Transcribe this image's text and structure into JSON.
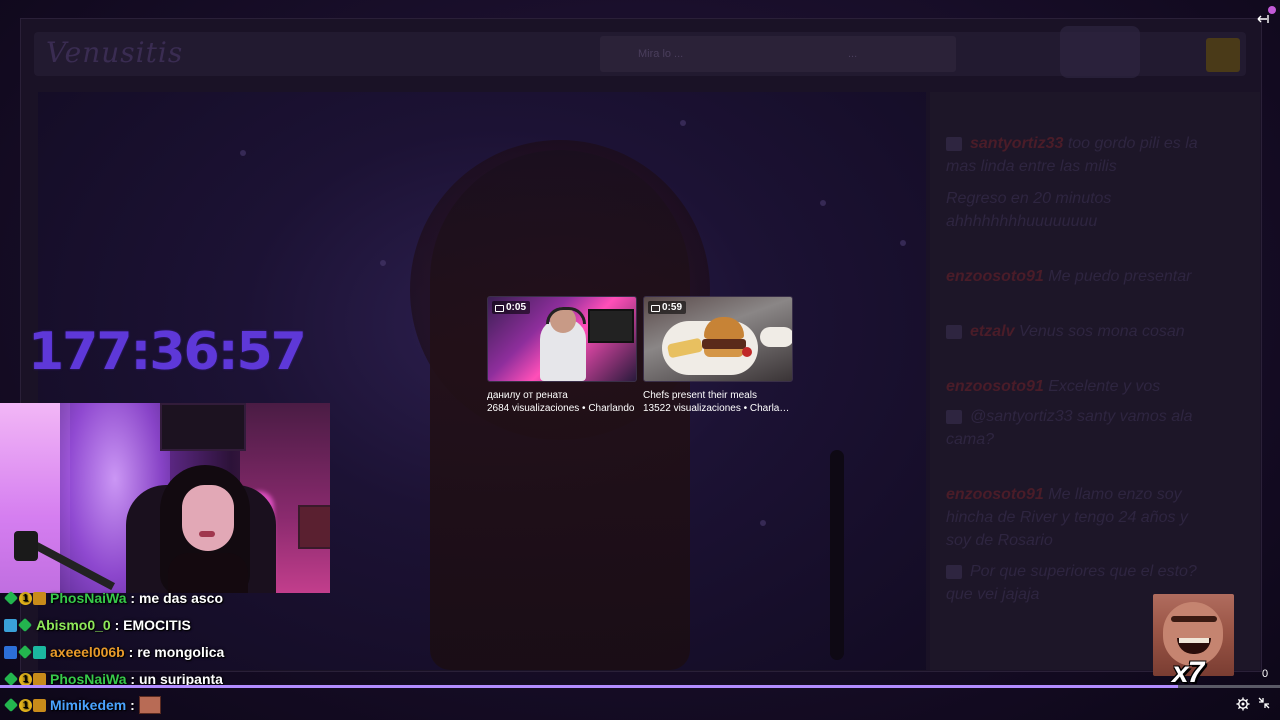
{
  "background": {
    "channel_logo_text": "Venusitis",
    "search_hint": "Mira lo ...",
    "search_hint_2": "..."
  },
  "background_chat": [
    {
      "user": "santyortiz33",
      "message": "too gordo pili es la mas linda entre las milis"
    },
    {
      "user": "",
      "message": "Regreso en 20 minutos ahhhhhhhhuuuuuuuu"
    },
    {
      "user": "enzoosoto91",
      "message": "Me puedo presentar"
    },
    {
      "user": "etzalv",
      "message": "Venus sos mona cosan"
    },
    {
      "user": "enzoosoto91",
      "message": "Excelente y vos"
    },
    {
      "user": "",
      "message": "@santyortiz33 santy vamos ala cama?"
    },
    {
      "user": "enzoosoto91",
      "message": "Me llamo enzo soy hincha de River y tengo 24 años y soy de Rosario"
    },
    {
      "user": "",
      "message": "Por que superiores que el esto? que vei jajaja"
    }
  ],
  "timer": "177:36:57",
  "suggestions": [
    {
      "duration": "0:05",
      "title": "данилу от рената",
      "meta": "2684 visualizaciones • Charlando"
    },
    {
      "duration": "0:59",
      "title": "Chefs present their meals",
      "meta": "13522 visualizaciones • Charlan..."
    }
  ],
  "overlay_chat": [
    {
      "user": "PhosNaiWa",
      "user_color": "#37c94a",
      "message": "me das asco",
      "badges": [
        "diamond",
        "one",
        "crown"
      ]
    },
    {
      "user": "Abismo0_0",
      "user_color": "#8ee85a",
      "message": "EMOCITIS",
      "badges": [
        "cube",
        "diamond"
      ]
    },
    {
      "user": "axeeel006b",
      "user_color": "#e89a2a",
      "message": "re mongolica",
      "badges": [
        "blue",
        "diamond",
        "teal"
      ]
    },
    {
      "user": "PhosNaiWa",
      "user_color": "#37c94a",
      "message": "un suripanta",
      "badges": [
        "diamond",
        "one",
        "crown"
      ]
    },
    {
      "user": "Mimikedem",
      "user_color": "#4aa3ff",
      "message": "",
      "badges": [
        "diamond",
        "one",
        "crown"
      ],
      "emote": true
    }
  ],
  "separator": ":",
  "meme_emote_count": "x7",
  "progress": {
    "fraction": 0.92,
    "count": "0"
  },
  "icons": {
    "settings": "gear-icon",
    "collapse": "collapse-icon",
    "exit": "exit-arrow-icon"
  },
  "colors": {
    "timer": "#5e38d8",
    "progress_fill": "#b28cff",
    "webcam_accent": "#ff5ee2"
  }
}
